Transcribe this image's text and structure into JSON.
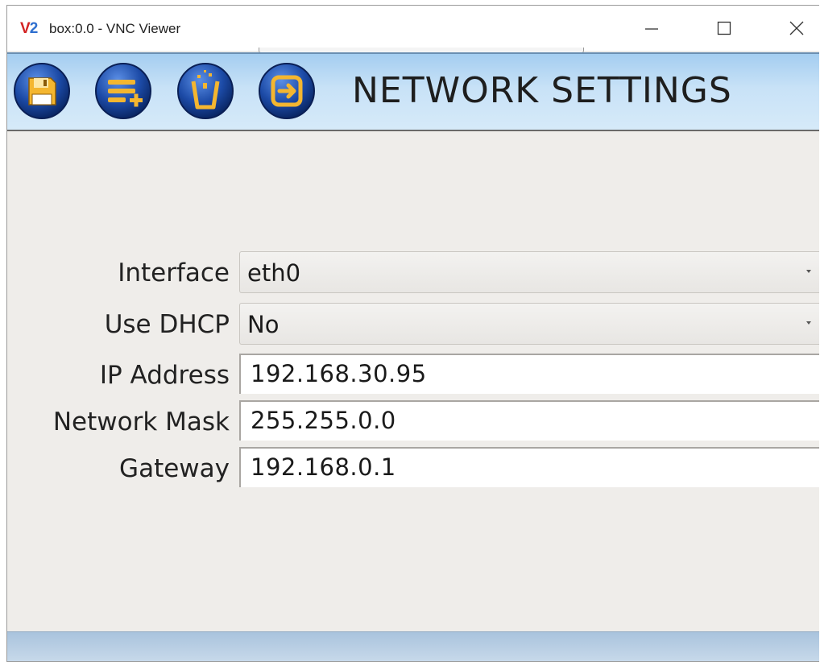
{
  "window": {
    "title": "box:0.0 - VNC Viewer",
    "logo_v": "V",
    "logo_2": "2"
  },
  "toolbar": {
    "buttons": [
      {
        "icon": "floppy-disk-save-icon"
      },
      {
        "icon": "list-add-icon"
      },
      {
        "icon": "trash-icon"
      },
      {
        "icon": "exit-icon"
      }
    ],
    "title": "NETWORK SETTINGS"
  },
  "form": {
    "interface": {
      "label": "Interface",
      "value": "eth0"
    },
    "use_dhcp": {
      "label": "Use DHCP",
      "value": "No"
    },
    "ip_address": {
      "label": "IP Address",
      "value": "192.168.30.95"
    },
    "network_mask": {
      "label": "Network Mask",
      "value": "255.255.0.0"
    },
    "gateway": {
      "label": "Gateway",
      "value": "192.168.0.1"
    }
  },
  "colors": {
    "icon_blue_dark": "#0b2f7a",
    "icon_blue_light": "#3f78d8",
    "icon_accent": "#f4b630",
    "toolbar_top": "#a4cdf0",
    "window_bg": "#efedea"
  }
}
